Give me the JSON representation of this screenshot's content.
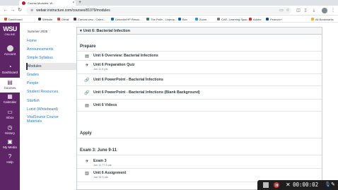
{
  "browser": {
    "tab_title": "Course Modules: W...",
    "tab_close": "×",
    "new_tab": "+",
    "url": "webair.instructure.com/courses/81079/modules",
    "bookmarks": [
      {
        "label": "Dashboard",
        "color": "#e34c26"
      },
      {
        "label": "Website",
        "color": "#444444"
      },
      {
        "label": "Gmail",
        "color": "#ea4335"
      },
      {
        "label": "Canvas wsu - Calen...",
        "color": "#5d2466"
      },
      {
        "label": "LinkedIn/HP Resou...",
        "color": "#0a66c2"
      },
      {
        "label": "The Palin - Linprop...",
        "color": "#3c7d4f"
      },
      {
        "label": "Box",
        "color": "#0061d5"
      },
      {
        "label": "Zoom",
        "color": "#2d8cff"
      },
      {
        "label": "CAE- Learning Spac...",
        "color": "#777777"
      },
      {
        "label": "Adobe",
        "color": "#e1251b"
      },
      {
        "label": "Pearson+",
        "color": "#0d4c8c"
      },
      {
        "label": "All Bookmarks",
        "color": "#f2b01e"
      }
    ]
  },
  "global_nav": {
    "logo_text": "WSU",
    "logo_sub": "ONLINE",
    "items": [
      {
        "label": "Account",
        "icon": "account-icon"
      },
      {
        "label": "Dashboard",
        "icon": "dashboard-icon"
      },
      {
        "label": "Courses",
        "icon": "courses-icon"
      },
      {
        "label": "Calendar",
        "icon": "calendar-icon"
      },
      {
        "label": "Inbox",
        "icon": "inbox-icon"
      },
      {
        "label": "History",
        "icon": "history-icon"
      },
      {
        "label": "My Media",
        "icon": "my-media-icon"
      },
      {
        "label": "Help",
        "icon": "help-icon"
      }
    ],
    "active_color": "#5d2466"
  },
  "course_nav": {
    "term": "Summer 2025",
    "items": [
      {
        "label": "Home"
      },
      {
        "label": "Announcements"
      },
      {
        "label": "Simple Syllabus"
      },
      {
        "label": "Modules"
      },
      {
        "label": "Grades"
      },
      {
        "label": "People"
      },
      {
        "label": "Student Resources"
      },
      {
        "label": "Starfish"
      },
      {
        "label": "Lucid (Whiteboard)"
      },
      {
        "label": "VitalSource Course Materials"
      }
    ]
  },
  "module": {
    "title": "Unit 6: Bacterial Infection",
    "prepare_heading": "Prepare",
    "apply_heading": "Apply",
    "exam_heading": "Exam 3: June 9-11",
    "items": [
      {
        "title": "Unit 6 Overview: Bacterial Infections",
        "meta": "",
        "icon": "page-icon"
      },
      {
        "title": "Unit 6 Preparation Quiz",
        "meta": "Jun 11   5 pts",
        "icon": "quiz-icon"
      },
      {
        "title": "Unit 6 PowerPoint - Bacterial Infections",
        "meta": "",
        "icon": "attachment-icon"
      },
      {
        "title": "Unit 6 PowerPoint - Bacterial Infections (Blank Background)",
        "meta": "",
        "icon": "attachment-icon"
      },
      {
        "title": "Unit 6 Videos",
        "meta": "",
        "icon": "page-icon"
      },
      {
        "title": "Exam 3",
        "meta": "Jun 11   77.5 pts",
        "icon": "quiz-icon"
      },
      {
        "title": "Unit 6 Assignment",
        "meta": "Jun 15   5 pts",
        "icon": "assignment-icon"
      }
    ]
  },
  "recorder": {
    "time": "00:00:02"
  }
}
